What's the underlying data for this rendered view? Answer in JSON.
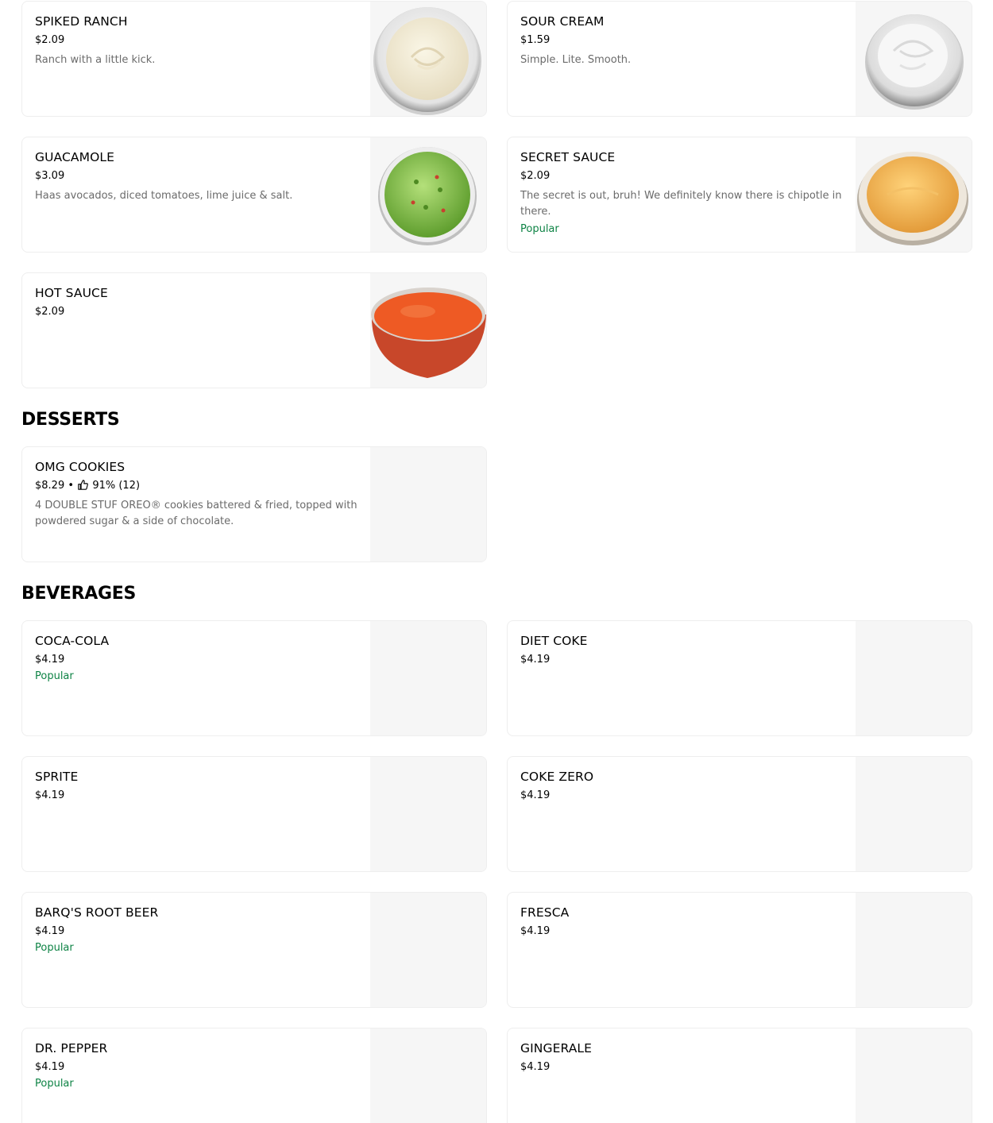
{
  "sauces": [
    {
      "name": "SPIKED RANCH",
      "price": "$2.09",
      "description": "Ranch with a little kick.",
      "badge": ""
    },
    {
      "name": "SOUR CREAM",
      "price": "$1.59",
      "description": "Simple. Lite. Smooth.",
      "badge": ""
    },
    {
      "name": "GUACAMOLE",
      "price": "$3.09",
      "description": "Haas avocados, diced tomatoes, lime juice & salt.",
      "badge": ""
    },
    {
      "name": "SECRET SAUCE",
      "price": "$2.09",
      "description": "The secret is out, bruh! We definitely know there is chipotle in there.",
      "badge": "Popular"
    },
    {
      "name": "HOT SAUCE",
      "price": "$2.09",
      "description": "",
      "badge": ""
    }
  ],
  "desserts": {
    "title": "DESSERTS",
    "items": [
      {
        "name": "OMG COOKIES",
        "price": "$8.29",
        "separator": "•",
        "rating": "91% (12)",
        "description": "4 DOUBLE STUF OREO® cookies battered & fried, topped with powdered sugar & a side of chocolate."
      }
    ]
  },
  "beverages": {
    "title": "BEVERAGES",
    "items": [
      {
        "name": "COCA-COLA",
        "price": "$4.19",
        "badge": "Popular"
      },
      {
        "name": "DIET COKE",
        "price": "$4.19",
        "badge": ""
      },
      {
        "name": "SPRITE",
        "price": "$4.19",
        "badge": ""
      },
      {
        "name": "COKE ZERO",
        "price": "$4.19",
        "badge": ""
      },
      {
        "name": "BARQ'S ROOT BEER",
        "price": "$4.19",
        "badge": "Popular"
      },
      {
        "name": "FRESCA",
        "price": "$4.19",
        "badge": ""
      },
      {
        "name": "DR. PEPPER",
        "price": "$4.19",
        "badge": "Popular"
      },
      {
        "name": "GINGERALE",
        "price": "$4.19",
        "badge": ""
      }
    ]
  },
  "colors": {
    "popular": "#0e8345",
    "description": "#6b6b6b",
    "border": "#eeeeee",
    "thumb_bg": "#f6f6f6"
  }
}
